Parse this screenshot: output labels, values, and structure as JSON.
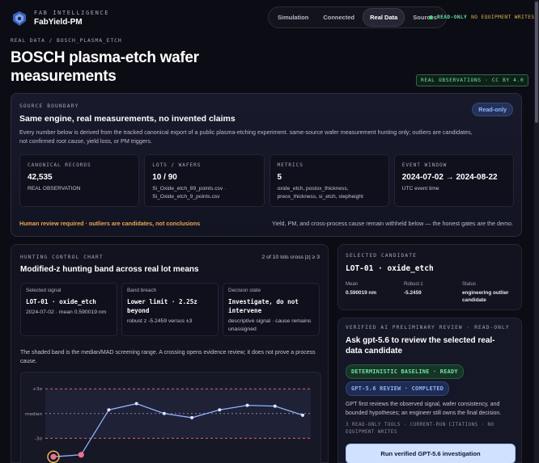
{
  "brand": {
    "kicker": "FAB INTELLIGENCE",
    "name": "FabYield-PM"
  },
  "nav": {
    "tabs": [
      "Simulation",
      "Connected",
      "Real Data",
      "Sources"
    ],
    "active": "Real Data"
  },
  "status": {
    "primary": "READ-ONLY",
    "secondary": "NO EQUIPMENT WRITES",
    "color": "#43d67d"
  },
  "breadcrumb": "REAL DATA / BOSCH_PLASMA_ETCH",
  "page_title": "BOSCH plasma-etch wafer measurements",
  "license_badge": "REAL OBSERVATIONS · CC BY 4.0",
  "source_boundary": {
    "kicker": "SOURCE BOUNDARY",
    "title": "Same engine, real measurements, no invented claims",
    "description": "Every number below is derived from the tracked canonical export of a public plasma-etching experiment. same-source wafer measurement hunting only; outliers are candidates, not confirmed root cause, yield loss, or PM triggers.",
    "badge": "Read-only",
    "stats": [
      {
        "label": "CANONICAL RECORDS",
        "value": "42,535",
        "sub": "REAL OBSERVATION"
      },
      {
        "label": "LOTS / WAFERS",
        "value": "10 / 90",
        "sub": "Si_Oxide_etch_89_points.csv · Si_Oxide_etch_9_points.csv"
      },
      {
        "label": "METRICS",
        "value": "5",
        "sub": "oxide_etch, postox_thickness, preox_thickness, si_etch, stepheight"
      },
      {
        "label": "EVENT WINDOW",
        "value": "2024-07-02 → 2024-08-22",
        "sub": "UTC event time"
      }
    ],
    "warning": "Human review required · outliers are candidates, not conclusions",
    "note": "Yield, PM, and cross-process cause remain withheld below — the honest gates are the demo."
  },
  "hunting": {
    "kicker": "HUNTING CONTROL CHART",
    "count": "2 of 10 lots cross |z| ≥ 3",
    "title": "Modified-z hunting band across real lot means",
    "cards": [
      {
        "label": "Selected signal",
        "value": "LOT-01 · oxide_etch",
        "sub": "2024-07-02 · mean 0.590019 nm"
      },
      {
        "label": "Band breach",
        "value": "Lower limit · 2.25z beyond",
        "sub": "robust z -5.2459 versus ±3"
      },
      {
        "label": "Decision state",
        "value": "Investigate, do not intervene",
        "sub": "descriptive signal · cause remains unassigned"
      }
    ],
    "description": "The shaded band is the median/MAD screening range. A crossing opens evidence review; it does not prove a process cause."
  },
  "chart_data": {
    "type": "line",
    "title": "",
    "x": [
      1,
      2,
      3,
      4,
      5,
      6,
      7,
      8,
      9,
      10
    ],
    "series": [
      {
        "values": [
          -5.2459,
          -5.0,
          0.45,
          1.2,
          0.0,
          -0.5,
          0.45,
          1.0,
          0.9,
          -0.2
        ]
      }
    ],
    "y_tick_labels": [
      "+3σ",
      "median",
      "-3σ"
    ],
    "ylim": [
      -6,
      4
    ],
    "band_limits": [
      -3,
      3
    ],
    "selected_index": 0,
    "colors": {
      "line": "#8fb4ff",
      "limit": "#e0607e",
      "outlier": "#f0708e",
      "selected_ring": "#f2c25a"
    }
  },
  "candidate": {
    "kicker": "SELECTED CANDIDATE",
    "title": "LOT-01 · oxide_etch",
    "cols": [
      {
        "label": "Mean",
        "value": "0.590019 nm"
      },
      {
        "label": "Robust z",
        "value": "-5.2459"
      },
      {
        "label": "Status",
        "value": "engineering outlier candidate"
      }
    ]
  },
  "ai_review": {
    "kicker": "VERIFIED AI PRELIMINARY REVIEW · READ-ONLY",
    "title": "Ask gpt-5.6 to review the selected real-data candidate",
    "pill_baseline": "DETERMINISTIC BASELINE · READY",
    "pill_review": "GPT-5.6 REVIEW · COMPLETED",
    "description": "GPT first reviews the observed signal, wafer consistency, and bounded hypotheses; an engineer still owns the final decision.",
    "meta": "3 READ-ONLY TOOLS · CURRENT-RUN CITATIONS · NO EQUIPMENT WRITES",
    "button": "Run verified GPT-5.6 investigation"
  }
}
